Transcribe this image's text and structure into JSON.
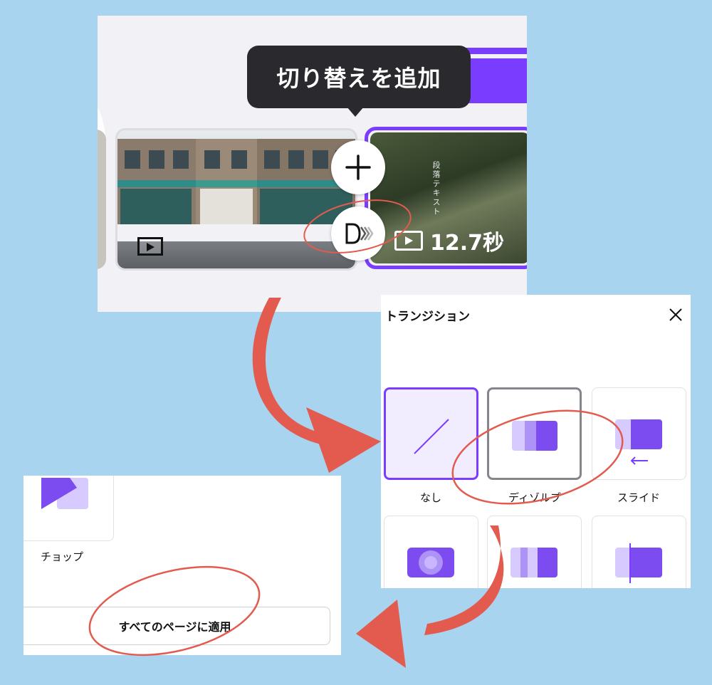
{
  "timeline": {
    "tooltip": "切り替えを追加",
    "clip_vertical_text": "段落テキスト",
    "duration": "12.7秒",
    "add_button_glyph": "+",
    "transition_button_icon": "transition-icon"
  },
  "transition_panel": {
    "title": "トランジション",
    "close_glyph": "✕",
    "options": [
      {
        "label": "なし",
        "selected": true
      },
      {
        "label": "ディゾルブ",
        "selected": false
      },
      {
        "label": "スライド",
        "selected": false
      }
    ]
  },
  "apply_panel": {
    "option_label": "チョップ",
    "apply_all_label": "すべてのページに適用"
  },
  "colors": {
    "background": "#a8d4ef",
    "accent": "#7a3dff",
    "annotation": "#e35a4f"
  }
}
